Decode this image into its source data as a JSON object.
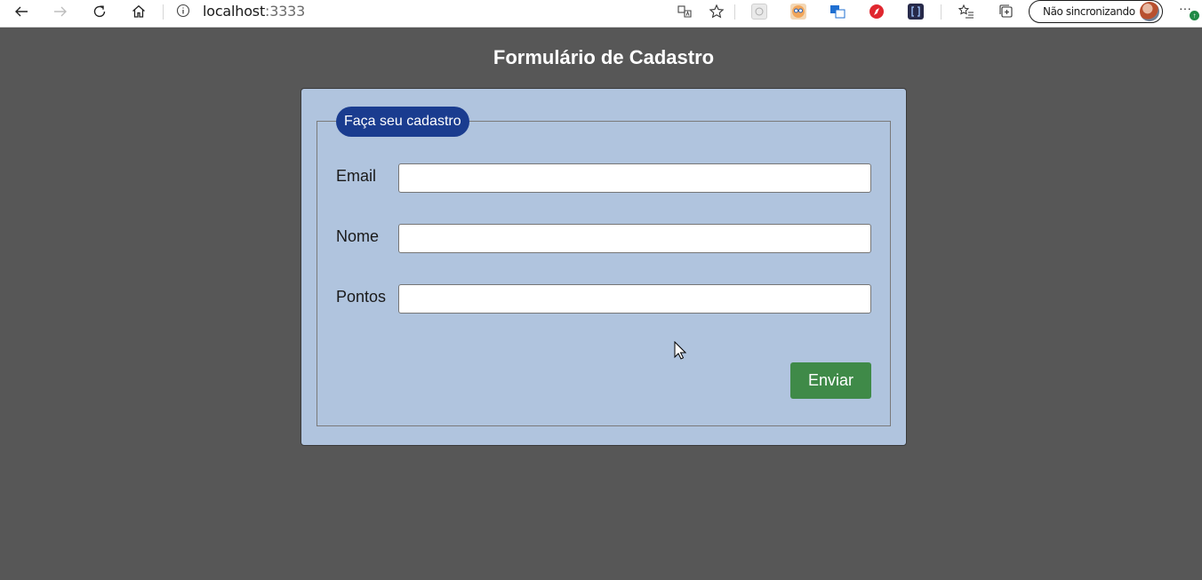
{
  "browser": {
    "url_host": "localhost",
    "url_port": ":3333",
    "sync_label": "Não sincronizando",
    "more_label": "···",
    "update_badge": "↑",
    "icons": [
      "back-arrow-icon",
      "forward-arrow-icon",
      "refresh-icon",
      "home-icon",
      "info-icon",
      "translate-icon",
      "favorite-star-icon",
      "extension-icon",
      "collections-icon"
    ]
  },
  "page": {
    "title": "Formulário de Cadastro"
  },
  "form": {
    "legend": "Faça seu cadastro",
    "fields": [
      {
        "label": "Email",
        "value": "",
        "placeholder": ""
      },
      {
        "label": "Nome",
        "value": "",
        "placeholder": ""
      },
      {
        "label": "Pontos",
        "value": "",
        "placeholder": ""
      }
    ],
    "submit_label": "Enviar"
  },
  "colors": {
    "page_background": "#575757",
    "card_background": "#b0c4de",
    "legend_background": "#1a3c8f",
    "submit_background": "#3f8a48"
  }
}
